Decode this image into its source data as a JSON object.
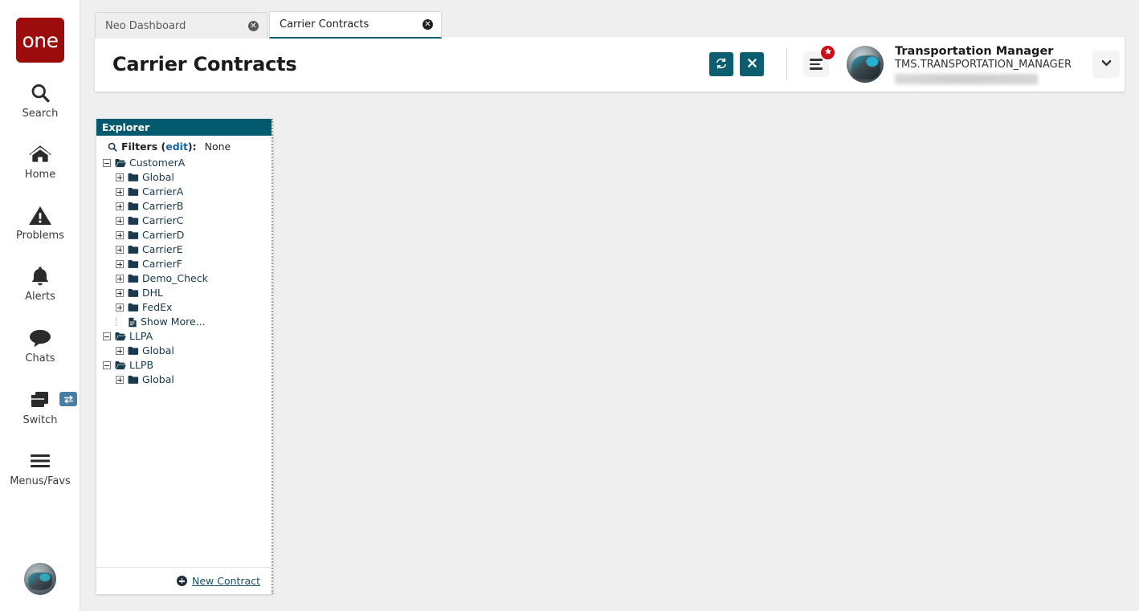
{
  "app": {
    "logo_text": "one",
    "brand_color": "#9d0c0c",
    "accent_color": "#0b5d70",
    "explorer_header_color": "#035a6e"
  },
  "rail": {
    "items": [
      {
        "label": "Search",
        "icon": "search-icon"
      },
      {
        "label": "Home",
        "icon": "home-icon"
      },
      {
        "label": "Problems",
        "icon": "warning-triangle-icon"
      },
      {
        "label": "Alerts",
        "icon": "bell-icon"
      },
      {
        "label": "Chats",
        "icon": "chat-bubble-icon"
      },
      {
        "label": "Switch",
        "icon": "windows-stack-icon"
      },
      {
        "label": "Menus/Favs",
        "icon": "hamburger-icon"
      }
    ],
    "switch_badge_icon": "swap-arrows-icon",
    "bottom_avatar": "user-avatar"
  },
  "tabs": [
    {
      "label": "Neo Dashboard",
      "active": false,
      "close_icon": "close-circle-icon"
    },
    {
      "label": "Carrier Contracts",
      "active": true,
      "close_icon": "close-circle-icon"
    }
  ],
  "header": {
    "title": "Carrier Contracts",
    "refresh_icon": "refresh-icon",
    "close_icon": "x-icon",
    "menu_icon": "list-menu-icon",
    "menu_badge_icon": "star-badge-icon",
    "user": {
      "name": "Transportation Manager",
      "role": "TMS.TRANSPORTATION_MANAGER",
      "org_redacted": ""
    },
    "dropdown_icon": "chevron-down-icon"
  },
  "explorer": {
    "title": "Explorer",
    "filters": {
      "icon": "search-icon",
      "label": "Filters (",
      "edit_label": "edit",
      "label_end": "):",
      "value": "None"
    },
    "tree": [
      {
        "level": 0,
        "label": "CustomerA",
        "state": "expanded",
        "icon": "open-folder-icon"
      },
      {
        "level": 1,
        "label": "Global",
        "state": "collapsed",
        "icon": "folder-icon"
      },
      {
        "level": 1,
        "label": "CarrierA",
        "state": "collapsed",
        "icon": "folder-icon"
      },
      {
        "level": 1,
        "label": "CarrierB",
        "state": "collapsed",
        "icon": "folder-icon"
      },
      {
        "level": 1,
        "label": "CarrierC",
        "state": "collapsed",
        "icon": "folder-icon"
      },
      {
        "level": 1,
        "label": "CarrierD",
        "state": "collapsed",
        "icon": "folder-icon"
      },
      {
        "level": 1,
        "label": "CarrierE",
        "state": "collapsed",
        "icon": "folder-icon"
      },
      {
        "level": 1,
        "label": "CarrierF",
        "state": "collapsed",
        "icon": "folder-icon"
      },
      {
        "level": 1,
        "label": "Demo_Check",
        "state": "collapsed",
        "icon": "folder-icon"
      },
      {
        "level": 1,
        "label": "DHL",
        "state": "collapsed",
        "icon": "folder-icon"
      },
      {
        "level": 1,
        "label": "FedEx",
        "state": "collapsed",
        "icon": "folder-icon"
      },
      {
        "level": 1,
        "label": "Show More...",
        "state": "leaf",
        "icon": "document-icon"
      },
      {
        "level": 0,
        "label": "LLPA",
        "state": "expanded",
        "icon": "open-folder-icon"
      },
      {
        "level": 1,
        "label": "Global",
        "state": "collapsed",
        "icon": "folder-icon"
      },
      {
        "level": 0,
        "label": "LLPB",
        "state": "expanded",
        "icon": "open-folder-icon"
      },
      {
        "level": 1,
        "label": "Global",
        "state": "collapsed",
        "icon": "folder-icon"
      }
    ],
    "footer": {
      "new_contract_label": "New Contract",
      "new_contract_icon": "plus-circle-icon"
    }
  }
}
